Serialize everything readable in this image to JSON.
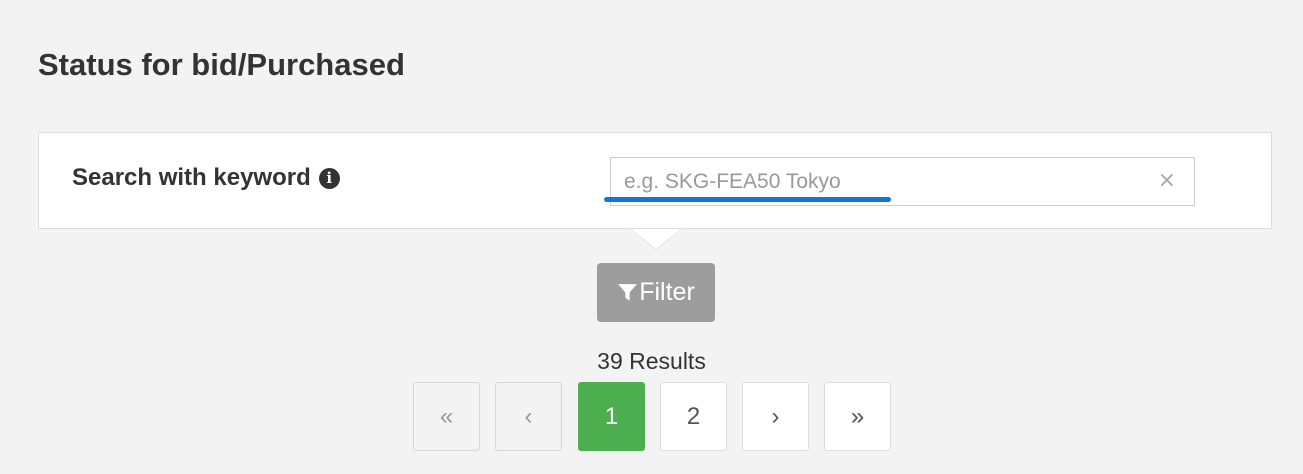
{
  "page": {
    "title": "Status for bid/Purchased"
  },
  "search": {
    "label": "Search with keyword",
    "info_icon": "info-circle-icon",
    "placeholder": "e.g. SKG-FEA50 Tokyo",
    "value": "",
    "clear_icon": "close-icon",
    "clear_glyph": "×",
    "annotation_color": "#0f78d7"
  },
  "filter": {
    "label": "Filter",
    "icon": "filter-icon"
  },
  "results": {
    "text": "39 Results"
  },
  "pagination": {
    "first": "«",
    "prev": "‹",
    "pages": [
      "1",
      "2"
    ],
    "current": "1",
    "next": "›",
    "last": "»"
  },
  "colors": {
    "background": "#f3f3f3",
    "active_page": "#4cae4f",
    "filter_button": "#9d9d9d",
    "text": "#333333"
  }
}
